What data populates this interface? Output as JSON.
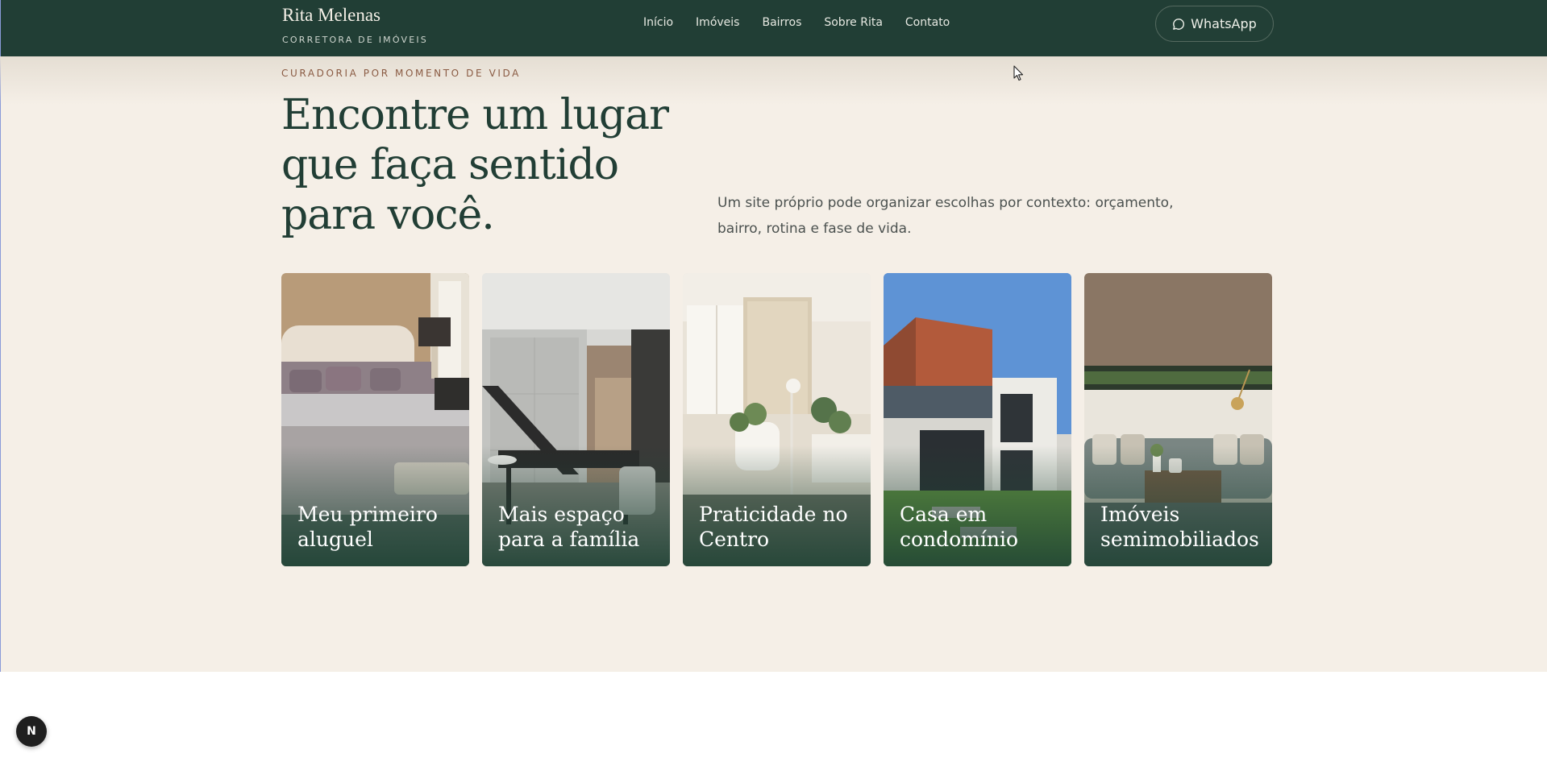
{
  "header": {
    "brand_name": "Rita Melenas",
    "brand_sub": "CORRETORA DE IMÓVEIS",
    "nav": [
      "Início",
      "Imóveis",
      "Bairros",
      "Sobre Rita",
      "Contato"
    ],
    "whatsapp_label": "WhatsApp"
  },
  "hero": {
    "eyebrow": "CURADORIA POR MOMENTO DE VIDA",
    "headline": "Encontre um lugar que faça sentido para você.",
    "lead": "Um site próprio pode organizar escolhas por contexto: orçamento, bairro, rotina e fase de vida."
  },
  "cards": [
    {
      "title": "Meu primeiro aluguel"
    },
    {
      "title": "Mais espaço para a família"
    },
    {
      "title": "Praticidade no Centro"
    },
    {
      "title": "Casa em condomínio"
    },
    {
      "title": "Imóveis semimobiliados"
    }
  ],
  "badge": {
    "label": "N"
  },
  "colors": {
    "header_bg": "#213e35",
    "hero_bg": "#f5efe7",
    "accent_eyebrow": "#8a5b43",
    "headline": "#213e35"
  },
  "icons": {
    "whatsapp": "chat-bubble-icon",
    "badge": "next-logo-icon",
    "cursor": "mouse-pointer-icon"
  }
}
